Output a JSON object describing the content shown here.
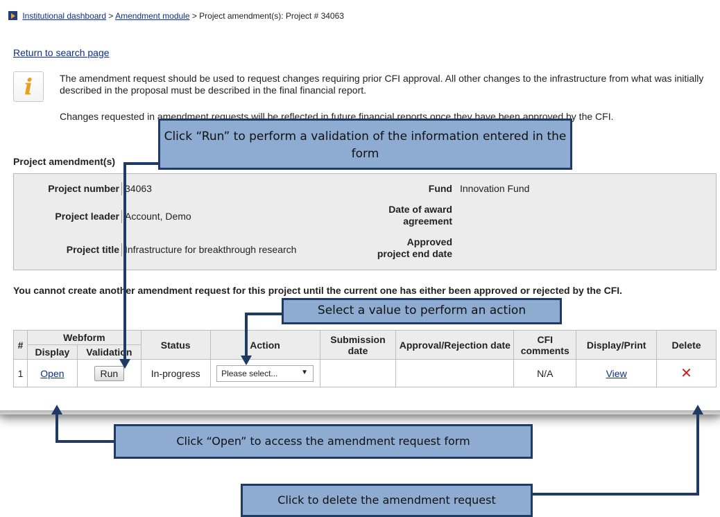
{
  "breadcrumb": {
    "link1": "Institutional dashboard",
    "sep1": " > ",
    "link2": "Amendment module",
    "tail": " > Project amendment(s): Project # 34063"
  },
  "return_link": "Return to search page",
  "info": {
    "para1": "The amendment request should be used to request changes requiring prior CFI approval. All other changes to the infrastructure from what was initially described in the proposal must be described in the final financial report.",
    "para2": "Changes requested in amendment requests will be reflected in future financial reports once they have been approved by the CFI."
  },
  "section_title": "Project amendment(s)",
  "summary": {
    "project_number_label": "Project number",
    "project_number": "34063",
    "project_leader_label": "Project leader",
    "project_leader": "Account, Demo",
    "project_title_label": "Project title",
    "project_title": "Infrastructure for breakthrough research",
    "fund_label": "Fund",
    "fund": "Innovation Fund",
    "award_date_label": "Date of award agreement",
    "end_date_label": "Approved project end date"
  },
  "warning": "You cannot create another amendment request for this project until the current one has either been approved or rejected by the CFI.",
  "table": {
    "headers": {
      "num": "#",
      "webform": "Webform",
      "display": "Display",
      "validation": "Validation",
      "status": "Status",
      "action": "Action",
      "submission": "Submission date",
      "approval": "Approval/Rejection date",
      "cfi": "CFI comments",
      "display_print": "Display/Print",
      "delete": "Delete"
    },
    "row": {
      "num": "1",
      "open": "Open",
      "run": "Run",
      "status": "In-progress",
      "action": "Please select...",
      "cfi": "N/A",
      "view": "View",
      "delete_icon": "✕"
    }
  },
  "callouts": {
    "run": "Click “Run” to perform a validation of the information entered in the form",
    "action": "Select a value to perform an action",
    "open": "Click “Open” to access the amendment request form",
    "delete": "Click to delete the amendment request"
  },
  "icons": {
    "breadcrumb": "breadcrumb-arrow-icon",
    "info": "info-icon",
    "delete": "delete-x-icon"
  },
  "colors": {
    "callout_fill": "#8eabd1",
    "callout_border": "#1f3a63",
    "link": "#0b2e8a",
    "delete": "#cc1b1b"
  }
}
